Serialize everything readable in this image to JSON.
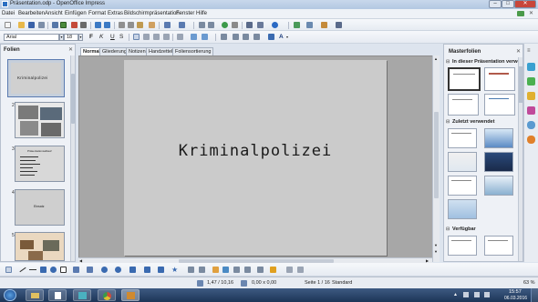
{
  "window": {
    "title": "Präsentation.odp - OpenOffice Impress",
    "btn_min": "–",
    "btn_max": "□",
    "btn_close": "✕"
  },
  "menu": [
    "Datei",
    "Bearbeiten",
    "Ansicht",
    "Einfügen",
    "Format",
    "Extras",
    "Bildschirmpräsentation",
    "Fenster",
    "Hilfe"
  ],
  "format_bar": {
    "font_name": "Arial",
    "font_size": "18",
    "bold": "F",
    "italic": "K",
    "underline": "U",
    "shadow": "S",
    "strike": "K"
  },
  "slides_panel": {
    "title": "Folien",
    "close": "✕",
    "slides": [
      {
        "number": "1",
        "title": "Kriminalpolizei"
      },
      {
        "number": "2",
        "title": ""
      },
      {
        "number": "3",
        "title": "Präsentationsablauf"
      },
      {
        "number": "4",
        "title": "Einsatz"
      },
      {
        "number": "5",
        "title": ""
      }
    ]
  },
  "view_tabs": [
    "Normal",
    "Gliederung",
    "Notizen",
    "Handzettel",
    "Foliensortierung"
  ],
  "slide": {
    "title": "Kriminalpolizei"
  },
  "master_panel": {
    "title": "Masterfolien",
    "close": "✕",
    "section_in_use": "In dieser Präsentation verwe",
    "section_recent": "Zuletzt verwendet",
    "section_available": "Verfügbar"
  },
  "status": {
    "position": "1,47 / 10,16",
    "size": "0,00 x 0,00",
    "slide_info": "Seite 1 / 16",
    "layout": "Standard",
    "zoom": "63 %"
  },
  "taskbar": {
    "time": "15:57",
    "date": "06.03.2016"
  },
  "colors": {
    "slide_bg": "#cbcbcb",
    "slide_text": "#1a1a1a",
    "workspace": "#a7a7a7"
  }
}
